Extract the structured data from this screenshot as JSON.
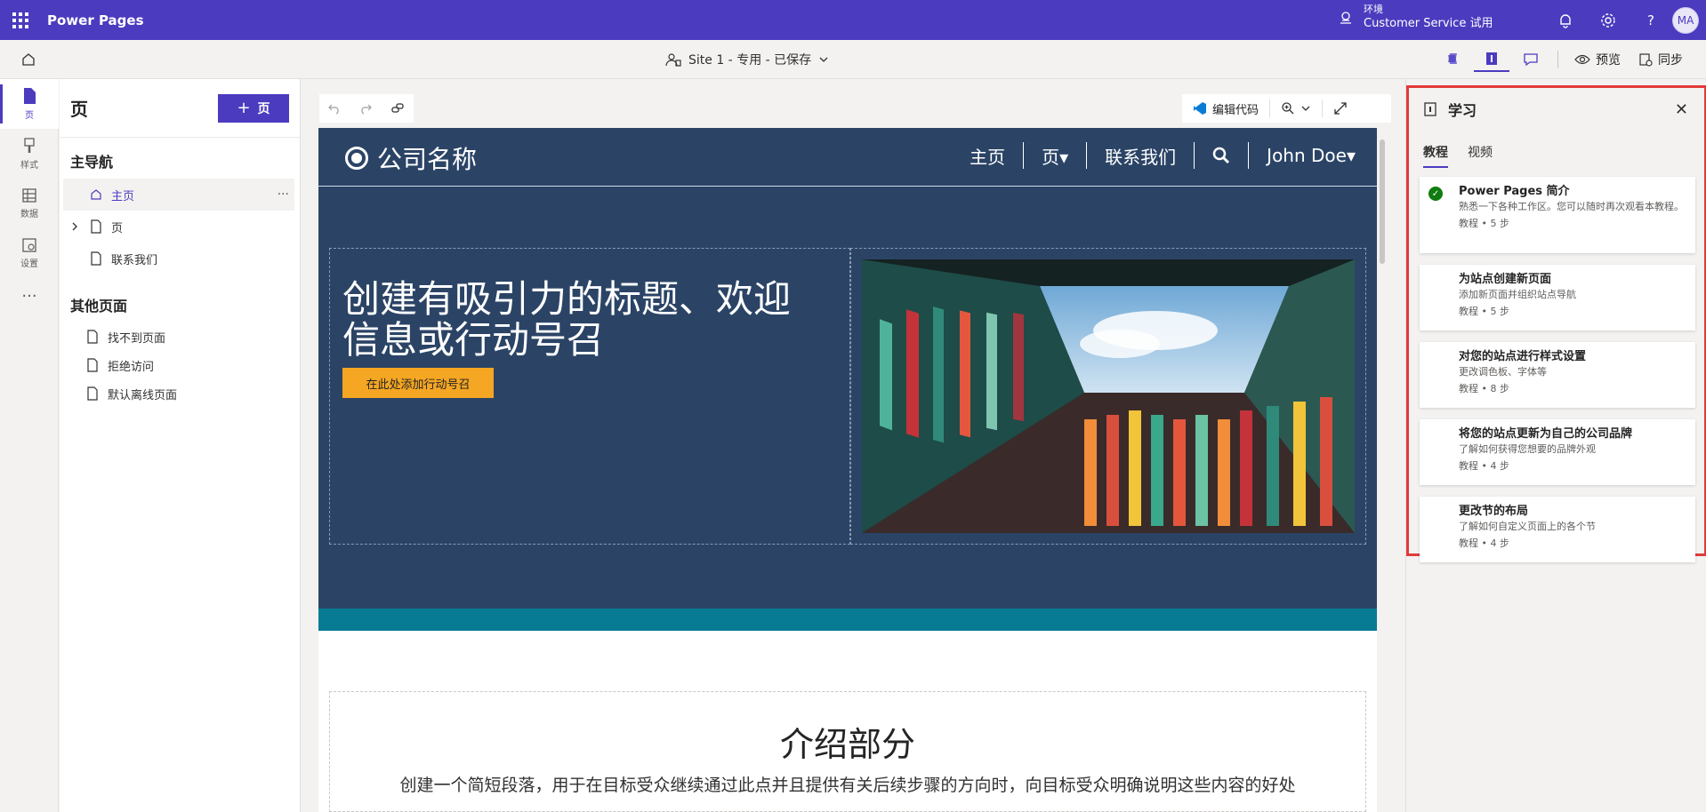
{
  "topbar": {
    "app_title": "Power Pages",
    "env_label": "环境",
    "env_name": "Customer Service 试用",
    "avatar": "MA"
  },
  "cmdbar": {
    "site_info": "Site 1 - 专用 - 已保存",
    "preview_label": "预览",
    "sync_label": "同步"
  },
  "rail": {
    "items": [
      {
        "label": "页"
      },
      {
        "label": "样式"
      },
      {
        "label": "数据"
      },
      {
        "label": "设置"
      }
    ],
    "more": "···"
  },
  "pages_panel": {
    "title": "页",
    "add_label": "页",
    "main_nav_title": "主导航",
    "main_nav": [
      "主页",
      "页",
      "联系我们"
    ],
    "other_title": "其他页面",
    "other_pages": [
      "找不到页面",
      "拒绝访问",
      "默认离线页面"
    ]
  },
  "canvas": {
    "edit_code_label": "编辑代码",
    "site": {
      "brand": "公司名称",
      "menu": [
        "主页",
        "页▾",
        "联系我们",
        "John Doe▾"
      ],
      "hero_title": "创建有吸引力的标题、欢迎信息或行动号召",
      "cta_label": "在此处添加行动号召",
      "intro_title": "介绍部分",
      "intro_text": "创建一个简短段落，用于在目标受众继续通过此点并且提供有关后续步骤的方向时，向目标受众明确说明这些内容的好处"
    }
  },
  "learn": {
    "title": "学习",
    "tabs": [
      "教程",
      "视频"
    ],
    "cards": [
      {
        "title": "Power Pages 简介",
        "desc": "熟悉一下各种工作区。您可以随时再次观看本教程。",
        "meta": "教程 • 5 步",
        "done": true
      },
      {
        "title": "为站点创建新页面",
        "desc": "添加新页面并组织站点导航",
        "meta": "教程 • 5 步",
        "done": false
      },
      {
        "title": "对您的站点进行样式设置",
        "desc": "更改调色板、字体等",
        "meta": "教程 • 8 步",
        "done": false
      },
      {
        "title": "将您的站点更新为自己的公司品牌",
        "desc": "了解如何获得您想要的品牌外观",
        "meta": "教程 • 4 步",
        "done": false
      },
      {
        "title": "更改节的布局",
        "desc": "了解如何自定义页面上的各个节",
        "meta": "教程 • 4 步",
        "done": false
      }
    ]
  },
  "colors": {
    "brand": "#4b3bbf",
    "site_nav": "#2b4466",
    "teal": "#087b94",
    "cta": "#f5a623",
    "highlight": "#e23a3a",
    "success": "#107c10"
  }
}
